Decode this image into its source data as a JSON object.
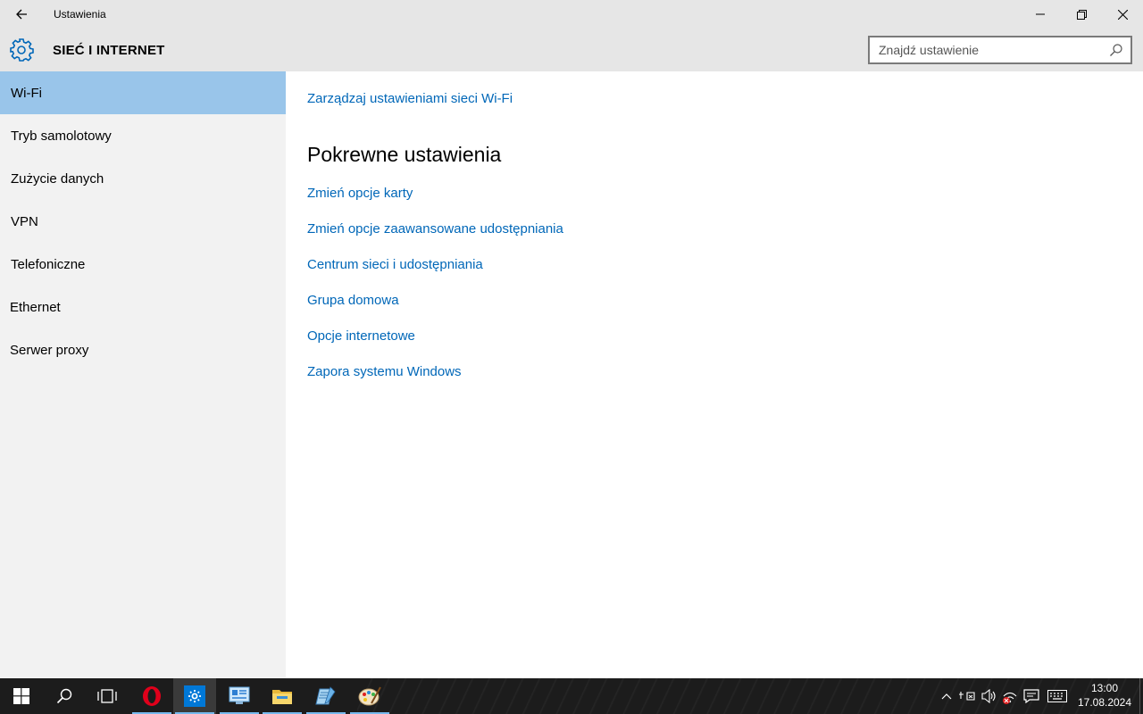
{
  "window": {
    "title": "Ustawienia",
    "section_title": "SIEĆ I INTERNET"
  },
  "search": {
    "placeholder": "Znajdź ustawienie"
  },
  "sidebar": {
    "items": [
      {
        "label": "Wi-Fi",
        "active": true
      },
      {
        "label": "Tryb samolotowy"
      },
      {
        "label": "Zużycie danych"
      },
      {
        "label": "VPN"
      },
      {
        "label": "Telefoniczne"
      },
      {
        "label": "Ethernet"
      },
      {
        "label": "Serwer proxy"
      }
    ]
  },
  "content": {
    "manage_link": "Zarządzaj ustawieniami sieci Wi-Fi",
    "related_heading": "Pokrewne ustawienia",
    "related_links": [
      "Zmień opcje karty",
      "Zmień opcje zaawansowane udostępniania",
      "Centrum sieci i udostępniania",
      "Grupa domowa",
      "Opcje internetowe",
      "Zapora systemu Windows"
    ]
  },
  "taskbar": {
    "time": "13:00",
    "date": "17.08.2024",
    "apps": [
      "start-icon",
      "search-icon",
      "task-view-icon",
      "opera-icon",
      "settings-icon",
      "control-panel-icon",
      "file-explorer-icon",
      "notepad-icon",
      "paint-icon"
    ]
  },
  "colors": {
    "accent": "#0067b8",
    "selection": "#99c5ea",
    "chrome": "#e6e6e6",
    "sidebar": "#f2f2f2",
    "taskbar": "#1c1c1c"
  }
}
